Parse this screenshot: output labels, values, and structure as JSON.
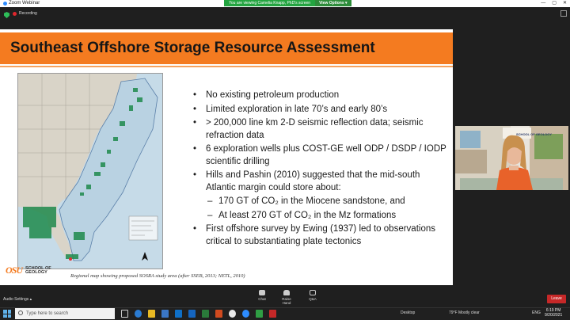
{
  "window": {
    "app_title": "Zoom Webinar"
  },
  "banner": {
    "viewing_text": "You are viewing Camelia Knapp, PhD's screen",
    "view_options": "View Options ▾"
  },
  "zoombar": {
    "recording_label": "Recording"
  },
  "slide": {
    "title": "Southeast Offshore Storage Resource Assessment",
    "bullets": [
      {
        "level": 1,
        "text": "No existing petroleum production"
      },
      {
        "level": 1,
        "text": "Limited exploration in late 70’s and early 80’s"
      },
      {
        "level": 1,
        "text": "> 200,000 line km 2-D seismic reflection data; seismic refraction data"
      },
      {
        "level": 1,
        "text": "6 exploration wells plus COST-GE well ODP / DSDP / IODP scientific drilling"
      },
      {
        "level": 1,
        "text": "Hills and Pashin (2010) suggested that the mid-south Atlantic margin could store about:"
      },
      {
        "level": 2,
        "text": "170 GT of CO₂ in the Miocene sandstone, and"
      },
      {
        "level": 2,
        "text": "At least 270 GT of CO₂ in the Mz formations"
      },
      {
        "level": 1,
        "text": "First offshore survey by Ewing (1937) led to observations critical to substantiating plate tectonics"
      }
    ],
    "bullet_marker": "•",
    "sub_marker": "–",
    "logo_mark": "OSU",
    "logo_line1": "SCHOOL OF GEOLOGY",
    "caption": "Regional map showing proposed SOSRA study area (after SSEB, 2013; NETL, 2010)"
  },
  "video": {
    "wall_sign": "SCHOOL OF GEOLOGY"
  },
  "meeting_controls": {
    "audio_settings": "Audio Settings ▴",
    "chat": "Chat",
    "raise_hand": "Raise Hand",
    "qa": "Q&A",
    "leave": "Leave"
  },
  "taskbar": {
    "search_placeholder": "Type here to search",
    "desktop": "Desktop",
    "weather": "79°F  Mostly clear",
    "lang": "ENG",
    "time": "6:19 PM",
    "date": "9/20/2021"
  },
  "colors": {
    "slide_orange": "#f47b20",
    "leave_red": "#c62828",
    "banner_green": "#23a440"
  }
}
